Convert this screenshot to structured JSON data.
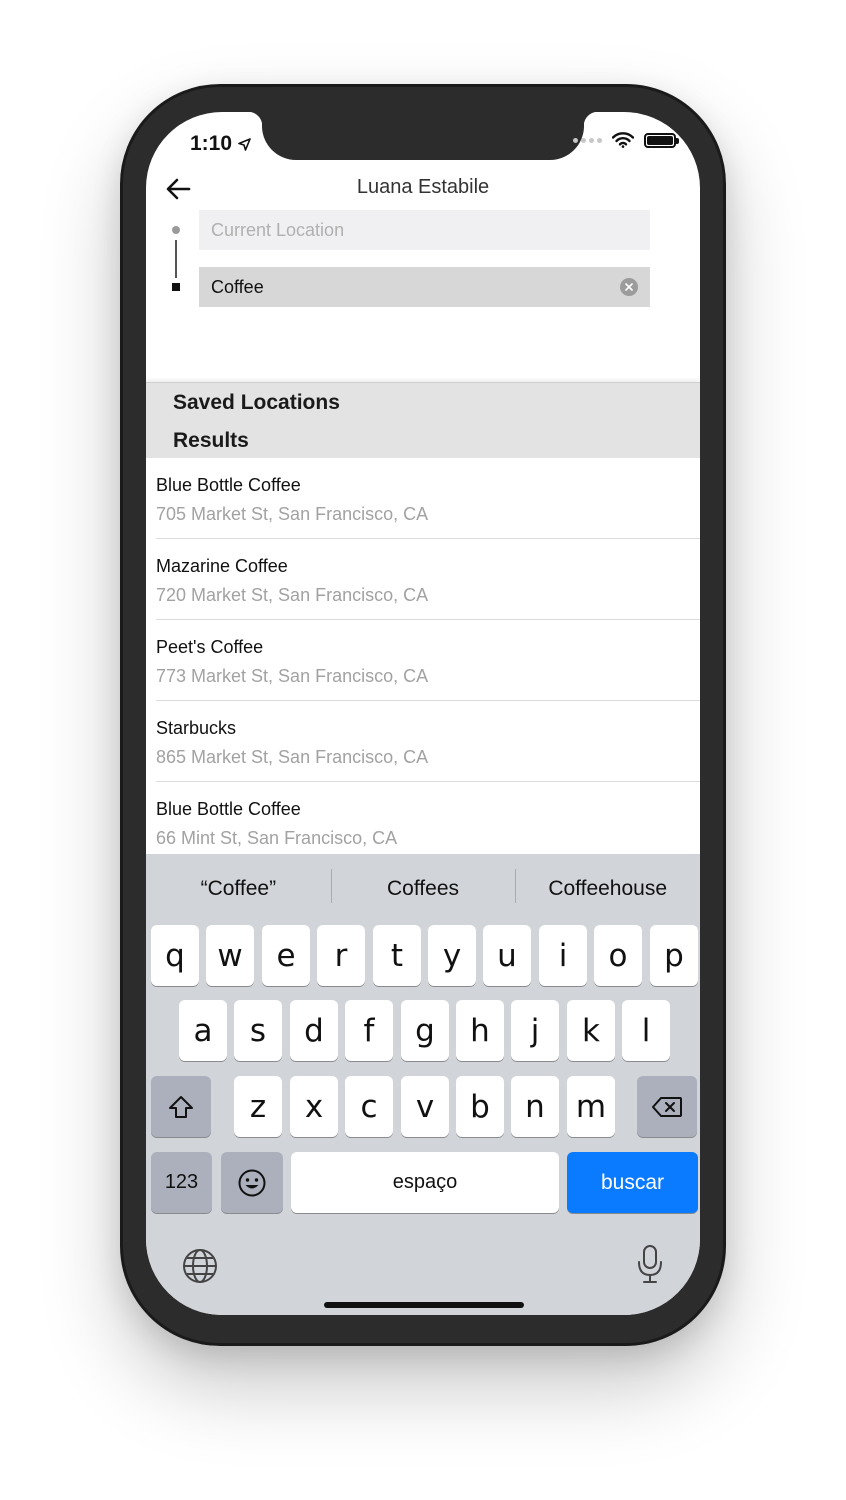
{
  "status_bar": {
    "time": "1:10"
  },
  "header": {
    "title": "Luana Estabile"
  },
  "search": {
    "origin_placeholder": "Current Location",
    "destination_value": "Coffee"
  },
  "sections": {
    "saved_label": "Saved Locations",
    "results_label": "Results"
  },
  "results": [
    {
      "name": "Blue Bottle Coffee",
      "address": "705 Market St, San Francisco, CA"
    },
    {
      "name": "Mazarine Coffee",
      "address": "720 Market St, San Francisco, CA"
    },
    {
      "name": "Peet's Coffee",
      "address": "773 Market St, San Francisco, CA"
    },
    {
      "name": "Starbucks",
      "address": "865 Market St, San Francisco, CA"
    },
    {
      "name": "Blue Bottle Coffee",
      "address": "66 Mint St, San Francisco, CA"
    }
  ],
  "keyboard": {
    "suggestions": [
      "“Coffee”",
      "Coffees",
      "Coffeehouse"
    ],
    "row1": [
      "q",
      "w",
      "e",
      "r",
      "t",
      "y",
      "u",
      "i",
      "o",
      "p"
    ],
    "row2": [
      "a",
      "s",
      "d",
      "f",
      "g",
      "h",
      "j",
      "k",
      "l"
    ],
    "row3": [
      "z",
      "x",
      "c",
      "v",
      "b",
      "n",
      "m"
    ],
    "numbers_label": "123",
    "space_label": "espaço",
    "return_label": "buscar"
  },
  "colors": {
    "accent": "#0a7aff",
    "keyboard_bg": "#d1d4d9"
  }
}
